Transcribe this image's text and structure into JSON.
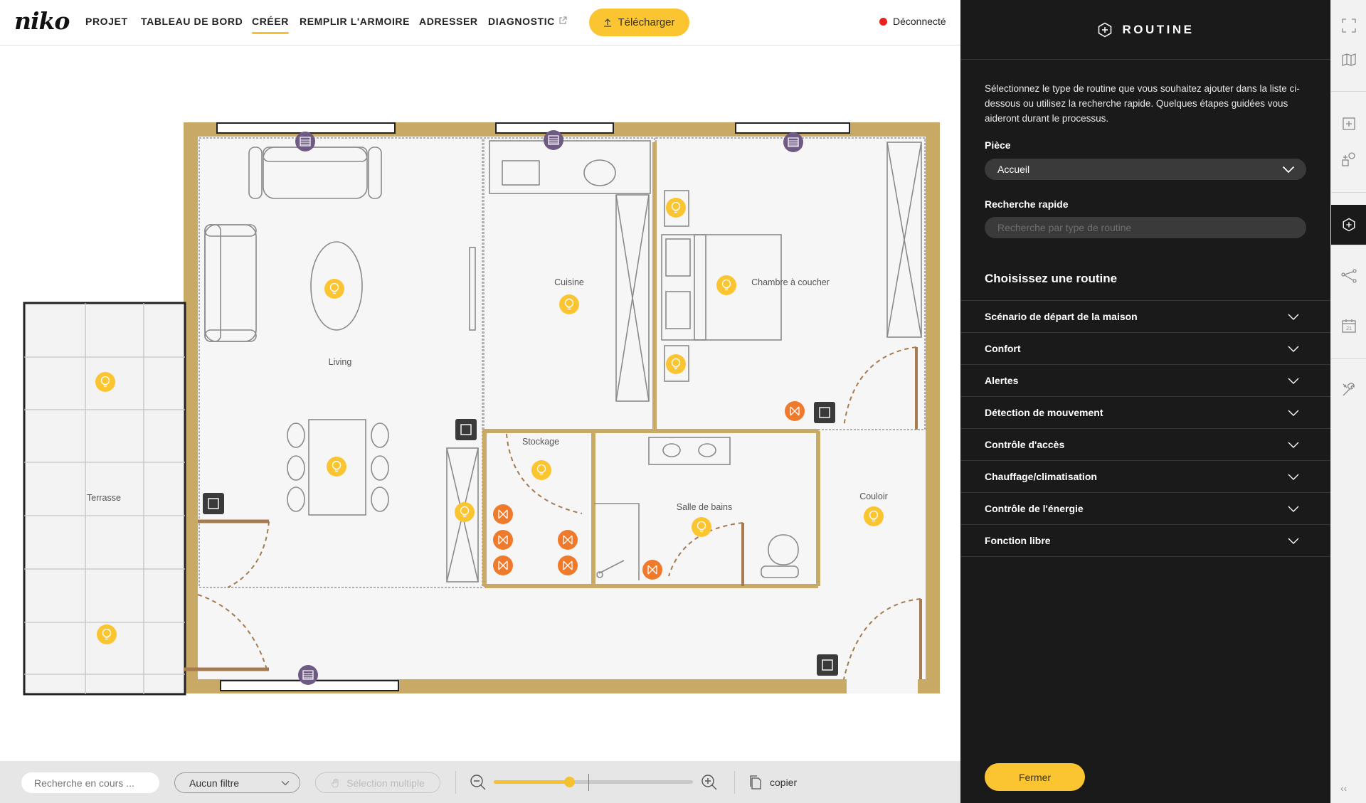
{
  "brand": {
    "logo": "niko",
    "accent": "#fbc531",
    "status_color": "#e8221e"
  },
  "nav": {
    "items": [
      {
        "label": "PROJET",
        "active": false
      },
      {
        "label": "TABLEAU DE BORD",
        "active": false
      },
      {
        "label": "CRÉER",
        "active": true
      },
      {
        "label": "REMPLIR L'ARMOIRE",
        "active": false
      },
      {
        "label": "ADRESSER",
        "active": false
      },
      {
        "label": "DIAGNOSTIC",
        "active": false,
        "icon": "external-link-icon"
      }
    ],
    "download_label": "Télécharger",
    "status_label": "Déconnecté"
  },
  "plan": {
    "rooms": [
      "Living",
      "Cuisine",
      "Chambre à coucher",
      "Terrasse",
      "Stockage",
      "Salle de bains",
      "Couloir"
    ]
  },
  "bottombar": {
    "search_placeholder": "Recherche en cours ...",
    "filter_label": "Aucun filtre",
    "multiselect_label": "Sélection multiple",
    "zoom_level": 0.38,
    "copy_label": "copier"
  },
  "panel": {
    "title": "ROUTINE",
    "description": "Sélectionnez le type de routine que vous souhaitez ajouter dans la liste ci-dessous ou utilisez la recherche rapide. Quelques étapes guidées vous aideront durant le processus.",
    "room_label": "Pièce",
    "room_value": "Accueil",
    "quick_search_label": "Recherche rapide",
    "quick_search_placeholder": "Recherche par type de routine",
    "choose_title": "Choisissez une routine",
    "routines": [
      "Scénario de départ de la maison",
      "Confort",
      "Alertes",
      "Détection de mouvement",
      "Contrôle d'accès",
      "Chauffage/climatisation",
      "Contrôle de l'énergie",
      "Fonction libre"
    ],
    "close_label": "Fermer"
  },
  "rail": {
    "icons": [
      "fullscreen-icon",
      "map-icon",
      "add-device-icon",
      "shapes-icon",
      "routine-icon",
      "network-icon",
      "calendar-icon",
      "tools-icon"
    ],
    "calendar_day": "21",
    "collapse": "‹‹"
  }
}
